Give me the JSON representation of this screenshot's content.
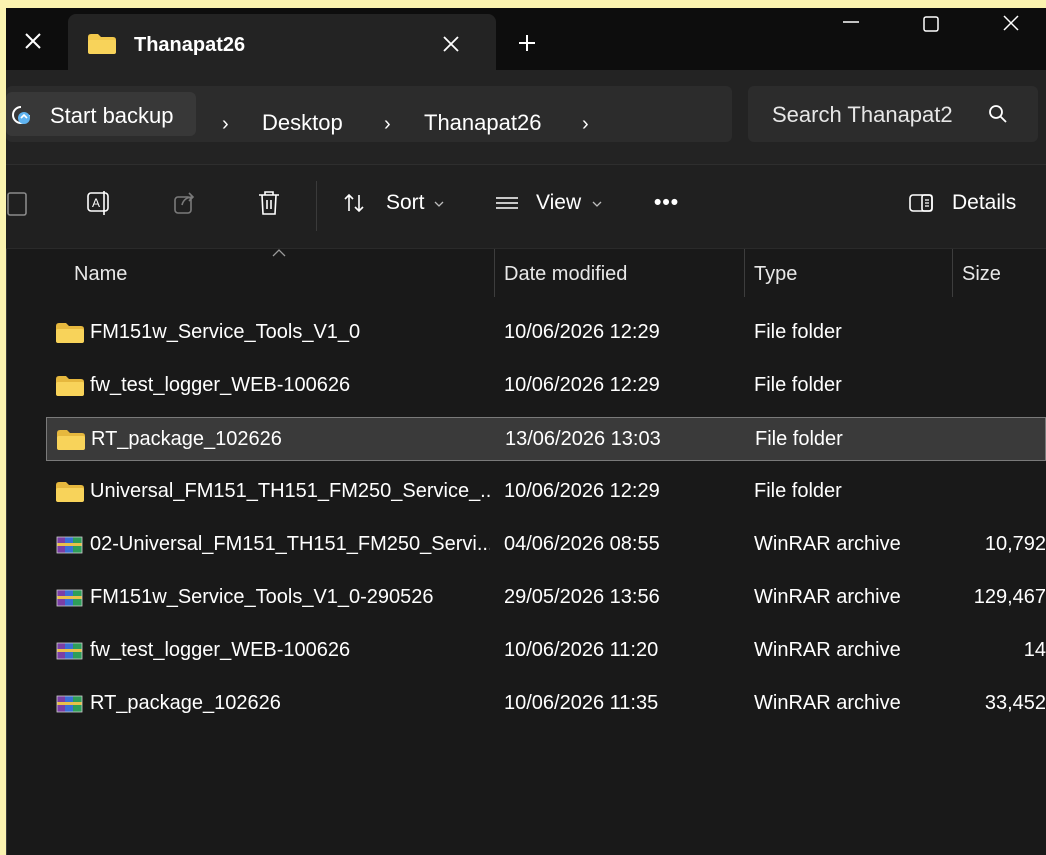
{
  "window": {
    "tab_title": "Thanapat26",
    "colors": {
      "background": "#191919",
      "accent_folder": "#f2c84b",
      "highlight": "#fbf3b0"
    }
  },
  "address": {
    "backup_label": "Start backup",
    "breadcrumbs": [
      "Desktop",
      "Thanapat26"
    ],
    "search_placeholder": "Search Thanapat2"
  },
  "toolbar": {
    "sort_label": "Sort",
    "view_label": "View",
    "more_label": "•••",
    "details_label": "Details"
  },
  "columns": {
    "name": "Name",
    "date": "Date modified",
    "type": "Type",
    "size": "Size"
  },
  "files": [
    {
      "name": "FM151w_Service_Tools_V1_0",
      "date": "10/06/2026 12:29",
      "type": "File folder",
      "size": "",
      "icon": "folder-icon"
    },
    {
      "name": "fw_test_logger_WEB-100626",
      "date": "10/06/2026 12:29",
      "type": "File folder",
      "size": "",
      "icon": "folder-icon"
    },
    {
      "name": "RT_package_102626",
      "date": "13/06/2026 13:03",
      "type": "File folder",
      "size": "",
      "icon": "folder-icon",
      "selected": true
    },
    {
      "name": "Universal_FM151_TH151_FM250_Service_...",
      "date": "10/06/2026 12:29",
      "type": "File folder",
      "size": "",
      "icon": "folder-icon"
    },
    {
      "name": "02-Universal_FM151_TH151_FM250_Servi...",
      "date": "04/06/2026 08:55",
      "type": "WinRAR archive",
      "size": "10,792",
      "icon": "winrar-archive-icon"
    },
    {
      "name": "FM151w_Service_Tools_V1_0-290526",
      "date": "29/05/2026 13:56",
      "type": "WinRAR archive",
      "size": "129,467",
      "icon": "winrar-archive-icon"
    },
    {
      "name": "fw_test_logger_WEB-100626",
      "date": "10/06/2026 11:20",
      "type": "WinRAR archive",
      "size": "14",
      "icon": "winrar-archive-icon"
    },
    {
      "name": "RT_package_102626",
      "date": "10/06/2026 11:35",
      "type": "WinRAR archive",
      "size": "33,452",
      "icon": "winrar-archive-icon"
    }
  ]
}
